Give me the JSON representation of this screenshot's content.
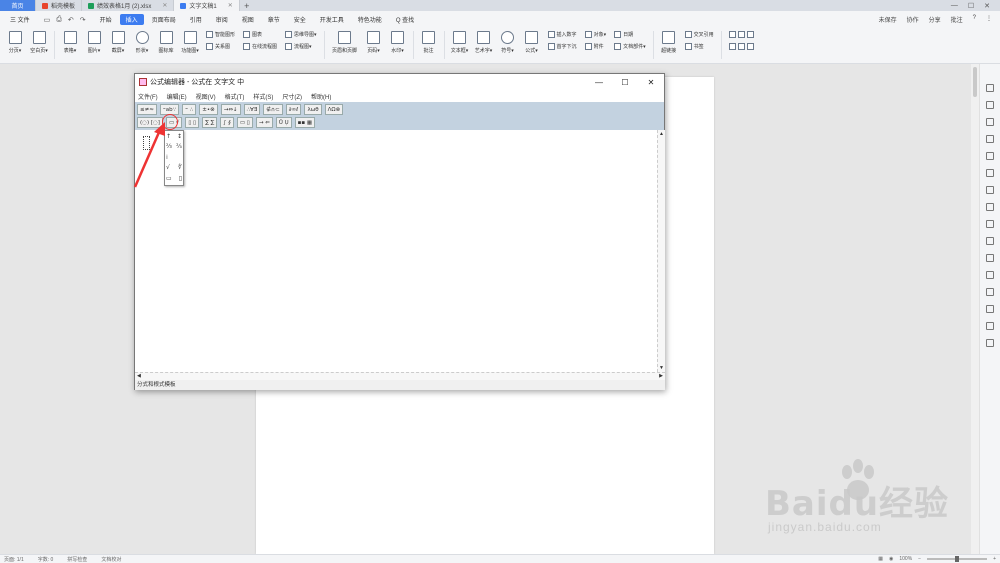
{
  "tabs": {
    "home": "首页",
    "t1": "稻壳模板",
    "t2": "绩效表格1月 (2).xlsx",
    "t3": "文字文稿1",
    "new": "+"
  },
  "menu": {
    "file": "三 文件",
    "items": [
      "开始",
      "插入",
      "页面布局",
      "引用",
      "审阅",
      "视图",
      "章节",
      "安全",
      "开发工具",
      "特色功能",
      "Q 查找"
    ],
    "right": [
      "未保存",
      "协作",
      "分享",
      "批注"
    ]
  },
  "ribbon": {
    "tools1": [
      {
        "label": "分页▾"
      },
      {
        "label": "空白页▾"
      },
      {
        "label": "表格▾"
      },
      {
        "label": "图片▾"
      },
      {
        "label": "截屏▾"
      },
      {
        "label": "形状▾"
      },
      {
        "label": "图标库"
      },
      {
        "label": "功能图▾"
      }
    ],
    "group1": [
      "智能图形",
      "关系图"
    ],
    "group2": [
      "图表",
      "在线流程图"
    ],
    "group3": [
      "思维导图▾",
      "流程图▾"
    ],
    "tools2": [
      {
        "label": "页眉和页脚"
      },
      {
        "label": "页码▾"
      },
      {
        "label": "水印▾"
      },
      {
        "label": "批注"
      },
      {
        "label": "文本框▾"
      },
      {
        "label": "艺术字▾"
      },
      {
        "label": "符号▾"
      },
      {
        "label": "公式▾"
      }
    ],
    "group4": [
      "插入数字",
      "首字下沉"
    ],
    "group5": [
      "对象▾",
      "附件"
    ],
    "group6": [
      "日期",
      "文档部件▾"
    ],
    "tools3": [
      {
        "label": "超链接"
      }
    ],
    "group7": [
      "交叉引用",
      "书签"
    ]
  },
  "eq_editor": {
    "title": "公式编辑器 - 公式在 文字文 中",
    "menu": [
      "文件(F)",
      "编辑(E)",
      "视图(V)",
      "格式(T)",
      "样式(S)",
      "尺寸(Z)",
      "帮助(H)"
    ],
    "row1": [
      "≤≠≈",
      "⁼ab∵",
      "⁼ ∴",
      "±•⊗",
      "→⇔↓",
      "∴∀∃",
      "∉∩⊂",
      "∂∞ℓ",
      "λωθ",
      "ΛΩ⊗"
    ],
    "row2": [
      "(◌) [◌]",
      "▭ √",
      "▯ ▯",
      "∑ ∑",
      "∫ ∮",
      "▭ ▯",
      "→ ⇐",
      "Ů Ụ",
      "▪▪ ▦"
    ],
    "dropdown": [
      [
        "↑",
        "↕"
      ],
      [
        "⅔",
        "⅖"
      ],
      [
        "⁞",
        ""
      ],
      [
        "√",
        "∜"
      ],
      [
        "▭",
        "▯"
      ]
    ],
    "status": "分式和根式模板"
  },
  "status": {
    "left": [
      "页面: 1/1",
      "字数: 0",
      "拼写检查",
      "文档校对"
    ],
    "zoom": "100%"
  },
  "watermark": {
    "brand": "Baidu经验",
    "url": "jingyan.baidu.com"
  },
  "colors": {
    "accent": "#3c7cf0",
    "home_tab": "#4a84e6",
    "eq_toolbar": "#c3d2e0",
    "annotation": "#ee3333"
  }
}
